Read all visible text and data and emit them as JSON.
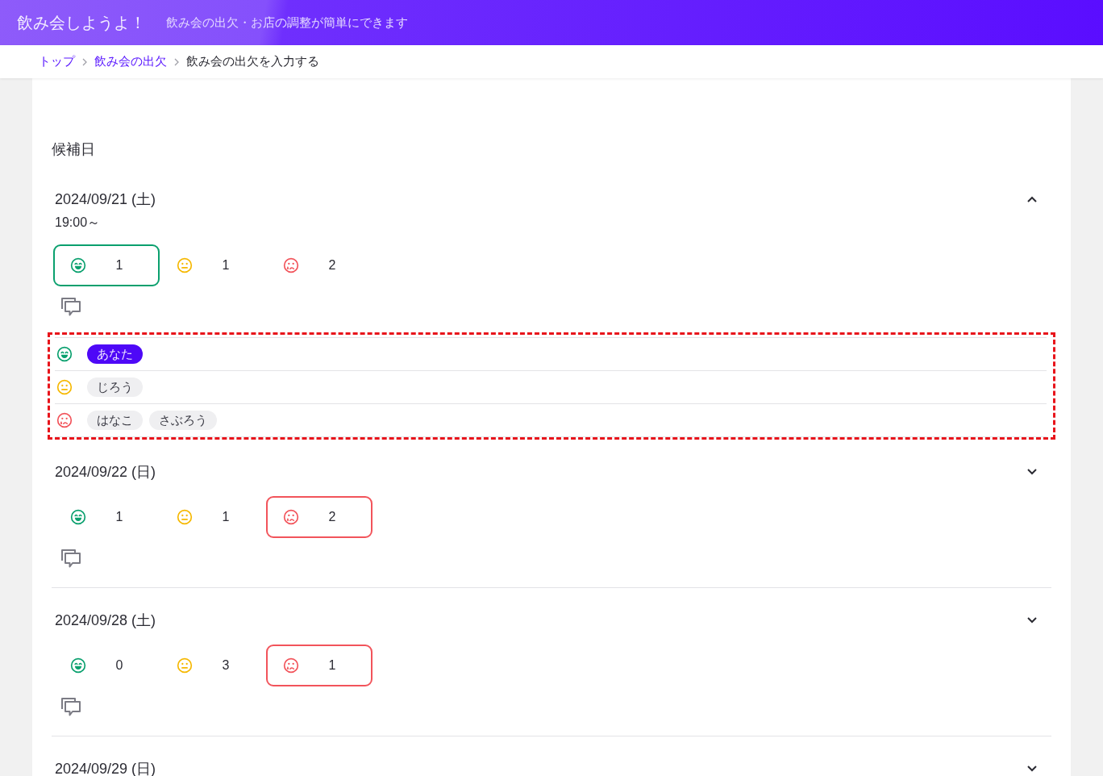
{
  "header": {
    "title": "飲み会しようよ！",
    "tagline": "飲み会の出欠・お店の調整が簡単にできます"
  },
  "breadcrumb": [
    {
      "label": "トップ",
      "kind": "link"
    },
    {
      "label": "飲み会の出欠",
      "kind": "link"
    },
    {
      "label": "飲み会の出欠を入力する",
      "kind": "current"
    }
  ],
  "section_title": "候補日",
  "candidates": [
    {
      "date": "2024/09/21 (土)",
      "time": "19:00～",
      "expanded": true,
      "choices": [
        {
          "kind": "yes",
          "count": "1",
          "selected": true
        },
        {
          "kind": "maybe",
          "count": "1",
          "selected": false
        },
        {
          "kind": "no",
          "count": "2",
          "selected": false
        }
      ],
      "responses": [
        {
          "kind": "yes",
          "names": [
            {
              "name": "あなた",
              "self": true
            }
          ]
        },
        {
          "kind": "maybe",
          "names": [
            {
              "name": "じろう",
              "self": false
            }
          ]
        },
        {
          "kind": "no",
          "names": [
            {
              "name": "はなこ",
              "self": false
            },
            {
              "name": "さぶろう",
              "self": false
            }
          ]
        }
      ]
    },
    {
      "date": "2024/09/22 (日)",
      "expanded": false,
      "choices": [
        {
          "kind": "yes",
          "count": "1",
          "selected": false
        },
        {
          "kind": "maybe",
          "count": "1",
          "selected": false
        },
        {
          "kind": "no",
          "count": "2",
          "selected": true
        }
      ]
    },
    {
      "date": "2024/09/28 (土)",
      "expanded": false,
      "choices": [
        {
          "kind": "yes",
          "count": "0",
          "selected": false
        },
        {
          "kind": "maybe",
          "count": "3",
          "selected": false
        },
        {
          "kind": "no",
          "count": "1",
          "selected": true
        }
      ]
    },
    {
      "date": "2024/09/29 (日)",
      "expanded": false
    }
  ]
}
